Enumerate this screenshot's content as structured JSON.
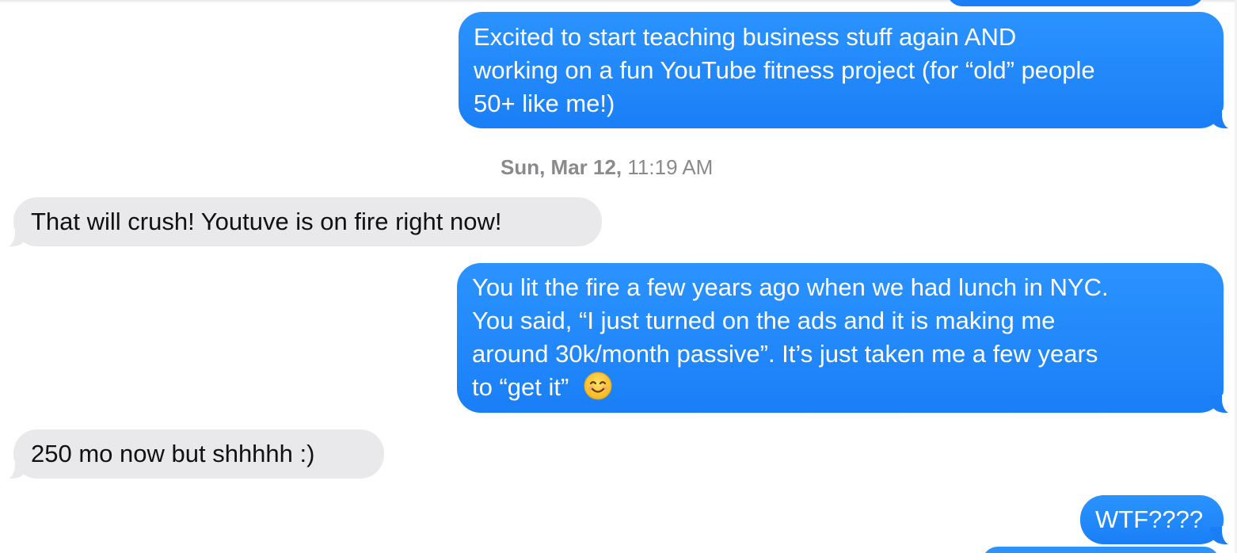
{
  "messages": [
    {
      "direction": "sent",
      "lines": [
        "Excited to start teaching business stuff again AND",
        "working on a fun YouTube fitness project (for “old” people",
        "50+ like me!)"
      ]
    },
    {
      "direction": "received",
      "lines": [
        "That will crush! Youtuve is on fire right now!"
      ]
    },
    {
      "direction": "sent",
      "lines": [
        "You lit the fire a few years ago when we had lunch in NYC.",
        "You said, “I just turned on the ads and it is making me",
        "around 30k/month passive”. It’s just taken me a few years",
        "to “get it”"
      ],
      "emoji": "smiling-face-emoji"
    },
    {
      "direction": "received",
      "lines": [
        "250 mo now but shhhhh :)"
      ]
    },
    {
      "direction": "sent",
      "lines": [
        "WTF????"
      ]
    }
  ],
  "timestamp": {
    "date": "Sun, Mar 12,",
    "time": "11:19 AM"
  },
  "colors": {
    "sent_bubble": "#1a7ff7",
    "received_bubble": "#e9e9eb",
    "timestamp_text": "#8a8a8e"
  }
}
